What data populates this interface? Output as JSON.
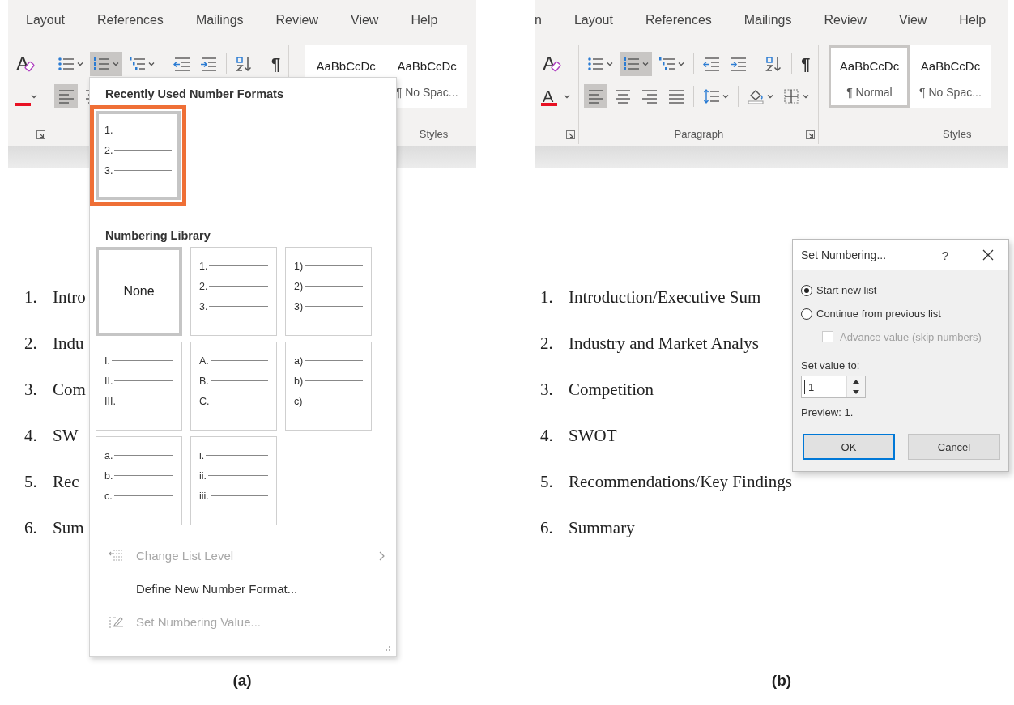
{
  "figures": [
    {
      "caption": "(a)",
      "tabs": [
        "Layout",
        "References",
        "Mailings",
        "Review",
        "View",
        "Help"
      ],
      "ribbon": [
        {
          "kind": "tools",
          "launcher": true,
          "rows": [
            [
              {
                "kind": "clear-formatting",
                "glyph": "A",
                "pressed": false
              }
            ],
            [
              {
                "kind": "font-color",
                "menu": true,
                "pressed": false
              }
            ]
          ]
        },
        {
          "kind": "tools",
          "rows": [
            [
              {
                "kind": "bullets",
                "menu": true,
                "pressed": false
              },
              {
                "kind": "numbering",
                "menu": true,
                "pressed": true
              },
              {
                "kind": "multilevel",
                "menu": true,
                "pressed": false
              },
              {
                "kind": "separator"
              },
              {
                "kind": "decrease-indent",
                "pressed": false
              },
              {
                "kind": "increase-indent",
                "pressed": false
              },
              {
                "kind": "separator"
              },
              {
                "kind": "sort",
                "pressed": false
              },
              {
                "kind": "separator"
              },
              {
                "kind": "show-marks",
                "glyph": "¶",
                "pressed": false
              }
            ],
            [
              {
                "kind": "align-left",
                "pressed": true
              },
              {
                "kind": "align-center",
                "pressed": false
              }
            ]
          ]
        },
        {
          "kind": "styles",
          "label": "Styles",
          "styles": [
            {
              "preview": "AaBbCcDc",
              "selected": false
            },
            {
              "preview": "AaBbCcDc",
              "name": "¶ No Spac...",
              "selected": false
            }
          ]
        }
      ],
      "document": [
        {
          "number": "1.",
          "text": "Intro"
        },
        {
          "number": "2.",
          "text": "Indu"
        },
        {
          "number": "3.",
          "text": "Com"
        },
        {
          "number": "4.",
          "text": "SW"
        },
        {
          "number": "5.",
          "text": "Rec"
        },
        {
          "number": "6.",
          "text": "Sum"
        }
      ],
      "number_menu": {
        "recent_heading": "Recently Used Number Formats",
        "recent": [
          {
            "markers": [
              "1.",
              "2.",
              "3."
            ],
            "selected": true,
            "highlighted": true
          }
        ],
        "library_heading": "Numbering Library",
        "library": [
          {
            "label": "None",
            "selected": true
          },
          {
            "markers": [
              "1.",
              "2.",
              "3."
            ],
            "selected": false
          },
          {
            "markers": [
              "1)",
              "2)",
              "3)"
            ],
            "selected": false
          },
          {
            "markers": [
              "I.",
              "II.",
              "III."
            ],
            "selected": false
          },
          {
            "markers": [
              "A.",
              "B.",
              "C."
            ],
            "selected": false
          },
          {
            "markers": [
              "a)",
              "b)",
              "c)"
            ],
            "selected": false
          },
          {
            "markers": [
              "a.",
              "b.",
              "c."
            ],
            "selected": false
          },
          {
            "markers": [
              "i.",
              "ii.",
              "iii."
            ],
            "selected": false
          }
        ],
        "items": [
          {
            "kind": "change-level",
            "label": "Change List Level",
            "disabled": true,
            "submenu": true
          },
          {
            "kind": "define",
            "label": "Define New Number Format...",
            "disabled": false
          },
          {
            "kind": "set-value",
            "label": "Set Numbering Value...",
            "disabled": true
          }
        ]
      }
    },
    {
      "caption": "(b)",
      "tabs": [
        "n",
        "Layout",
        "References",
        "Mailings",
        "Review",
        "View",
        "Help"
      ],
      "ribbon": [
        {
          "kind": "tools",
          "launcher": true,
          "rows": [
            [
              {
                "kind": "clear-formatting",
                "glyph": "A",
                "pressed": false
              }
            ],
            [
              {
                "kind": "font-color",
                "glyph": "A",
                "menu": true,
                "pressed": false
              }
            ]
          ]
        },
        {
          "kind": "tools",
          "launcher": true,
          "label": "Paragraph",
          "rows": [
            [
              {
                "kind": "bullets",
                "menu": true,
                "pressed": false
              },
              {
                "kind": "numbering",
                "menu": true,
                "pressed": true
              },
              {
                "kind": "multilevel",
                "menu": true,
                "pressed": false
              },
              {
                "kind": "separator"
              },
              {
                "kind": "decrease-indent",
                "pressed": false
              },
              {
                "kind": "increase-indent",
                "pressed": false
              },
              {
                "kind": "separator"
              },
              {
                "kind": "sort",
                "pressed": false
              },
              {
                "kind": "separator"
              },
              {
                "kind": "show-marks",
                "glyph": "¶",
                "pressed": false
              }
            ],
            [
              {
                "kind": "align-left",
                "pressed": true
              },
              {
                "kind": "align-center",
                "pressed": false
              },
              {
                "kind": "align-right",
                "pressed": false
              },
              {
                "kind": "justify",
                "pressed": false
              },
              {
                "kind": "separator"
              },
              {
                "kind": "line-spacing",
                "menu": true,
                "pressed": false
              },
              {
                "kind": "separator"
              },
              {
                "kind": "shading",
                "menu": true,
                "pressed": false
              },
              {
                "kind": "borders",
                "menu": true,
                "pressed": false
              }
            ]
          ]
        },
        {
          "kind": "styles",
          "label": "Styles",
          "styles": [
            {
              "preview": "AaBbCcDc",
              "name": "¶ Normal",
              "selected": true
            },
            {
              "preview": "AaBbCcDc",
              "name": "¶ No Spac...",
              "selected": false
            }
          ]
        }
      ],
      "document": [
        {
          "number": "1.",
          "text": "Introduction/Executive Sum"
        },
        {
          "number": "2.",
          "text": "Industry and Market Analys"
        },
        {
          "number": "3.",
          "text": "Competition"
        },
        {
          "number": "4.",
          "text": "SWOT"
        },
        {
          "number": "5.",
          "text": "Recommendations/Key Findings"
        },
        {
          "number": "6.",
          "text": "Summary"
        }
      ],
      "dialog": {
        "title": "Set Numbering...",
        "help": "?",
        "options": [
          {
            "label": "Start new list",
            "selected": true
          },
          {
            "label": "Continue from previous list",
            "selected": false
          }
        ],
        "advance": {
          "label": "Advance value (skip numbers)",
          "checked": false,
          "disabled": true
        },
        "value_label": "Set value to:",
        "value": "1",
        "preview": "Preview: 1.",
        "buttons": [
          {
            "label": "OK",
            "default": true
          },
          {
            "label": "Cancel",
            "default": false
          }
        ]
      }
    }
  ]
}
